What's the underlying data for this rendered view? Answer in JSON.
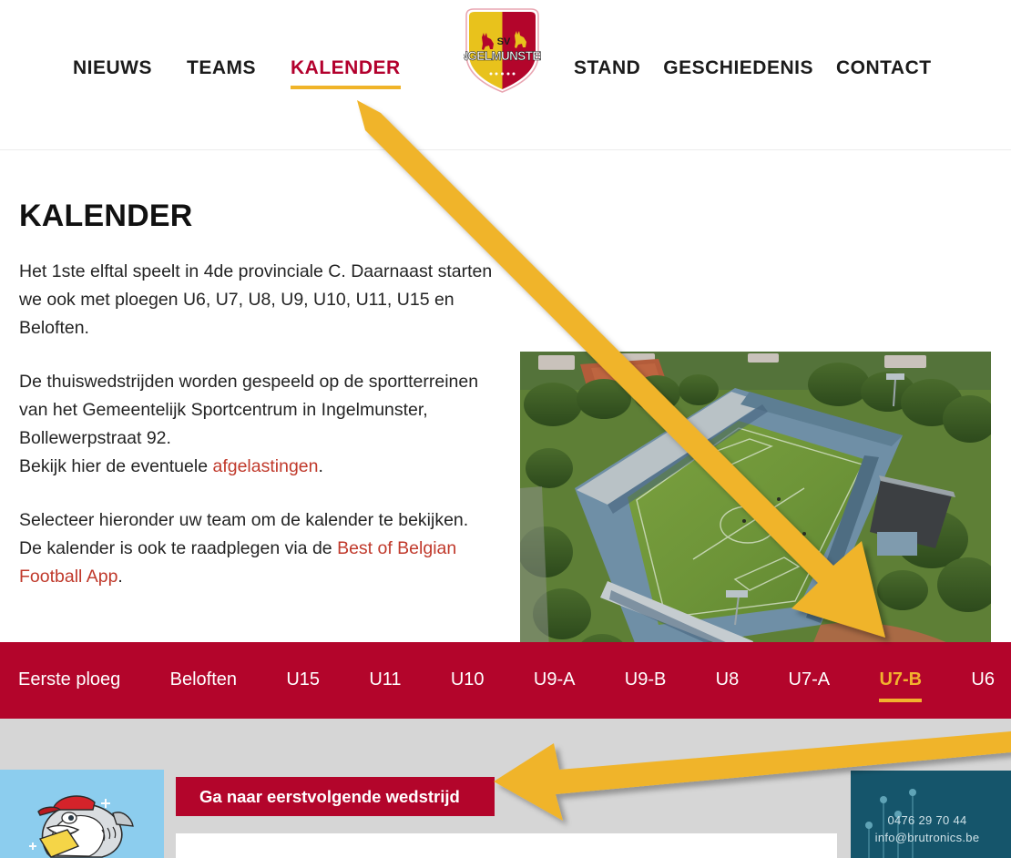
{
  "header": {
    "nav_left": [
      {
        "label": "NIEUWS",
        "active": false
      },
      {
        "label": "TEAMS",
        "active": false
      },
      {
        "label": "KALENDER",
        "active": true
      }
    ],
    "nav_right": [
      {
        "label": "STAND",
        "active": false
      },
      {
        "label": "GESCHIEDENIS",
        "active": false
      },
      {
        "label": "CONTACT",
        "active": false
      }
    ],
    "logo": {
      "name": "sv-ingelmunster-shield-logo",
      "top_text": "SV",
      "main_text": "INGELMUNSTER",
      "color_left": "#e8c21c",
      "color_right": "#b3052b"
    }
  },
  "main": {
    "title": "KALENDER",
    "paragraph_1_part_1": "Het 1ste elftal speelt in 4de provinciale C. Daarnaast starten we ook met ploegen U6, U7, U8, U9, U10, U11, U15 en Beloften.",
    "paragraph_2_line_1": "De thuiswedstrijden worden gespeeld op de sportterreinen van het Gemeentelijk Sportcentrum in Ingelmunster, Bollewerpstraat 92.",
    "paragraph_2_line_2_pre": "Bekijk hier de eventuele ",
    "paragraph_2_link": "afgelastingen",
    "paragraph_2_line_2_post": ".",
    "paragraph_3_pre": "Selecteer hieronder uw team om de kalender te bekijken. De kalender is ook te raadplegen via de ",
    "paragraph_3_link": "Best of Belgian Football App",
    "paragraph_3_post": ".",
    "photo_alt": "aerial-photo-football-stadium"
  },
  "team_bar": {
    "background": "#b3052b",
    "active_color": "#f2b22e",
    "tabs": [
      {
        "label": "Eerste ploeg",
        "active": false
      },
      {
        "label": "Beloften",
        "active": false
      },
      {
        "label": "U15",
        "active": false
      },
      {
        "label": "U11",
        "active": false
      },
      {
        "label": "U10",
        "active": false
      },
      {
        "label": "U9-A",
        "active": false
      },
      {
        "label": "U9-B",
        "active": false
      },
      {
        "label": "U8",
        "active": false
      },
      {
        "label": "U7-A",
        "active": false
      },
      {
        "label": "U7-B",
        "active": true
      },
      {
        "label": "U6",
        "active": false
      }
    ]
  },
  "calendar_section": {
    "cta_label": "Ga naar eerstvolgende wedstrijd"
  },
  "ads": {
    "left": {
      "name": "shark-mascot-ad",
      "background": "#8ccdee"
    },
    "right": {
      "name": "brutronics-ad",
      "background": "#15556b",
      "phone": "0476 29 70 44",
      "email": "info@brutronics.be"
    }
  },
  "annotations": {
    "arrow_color": "#f0b429",
    "arrow_1_target": "U7-B team tab",
    "arrow_2_target": "Ga naar eerstvolgende wedstrijd button"
  }
}
